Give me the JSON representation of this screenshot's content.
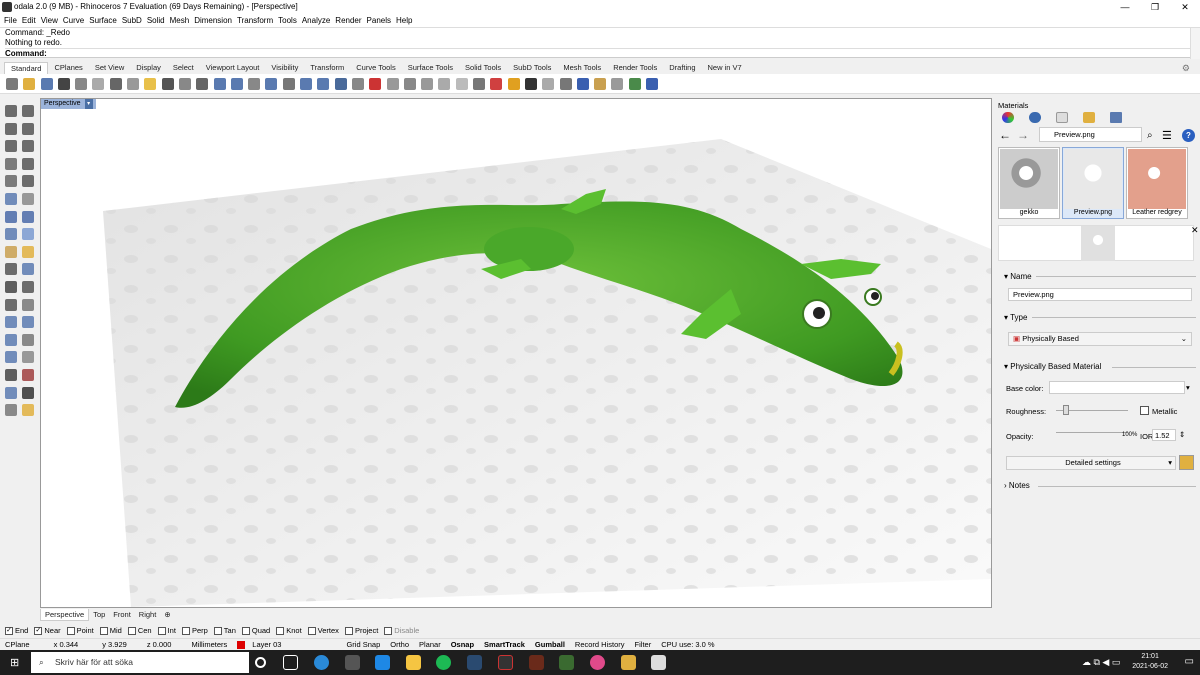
{
  "window": {
    "title": "odala 2.0 (9 MB) - Rhinoceros 7 Evaluation (69 Days Remaining) - [Perspective]",
    "controls": [
      "—",
      "❐",
      "✕"
    ]
  },
  "menu": [
    "File",
    "Edit",
    "View",
    "Curve",
    "Surface",
    "SubD",
    "Solid",
    "Mesh",
    "Dimension",
    "Transform",
    "Tools",
    "Analyze",
    "Render",
    "Panels",
    "Help"
  ],
  "command": {
    "history": [
      "Command: _Redo",
      "Nothing to redo."
    ],
    "prompt": "Command:"
  },
  "toolbar_tabs": [
    "Standard",
    "CPlanes",
    "Set View",
    "Display",
    "Select",
    "Viewport Layout",
    "Visibility",
    "Transform",
    "Curve Tools",
    "Surface Tools",
    "Solid Tools",
    "SubD Tools",
    "Mesh Tools",
    "Render Tools",
    "Drafting",
    "New in V7"
  ],
  "toolbar_icon_colors": [
    "#7a7a7a",
    "#e0b040",
    "#5a7ab0",
    "#444",
    "#888",
    "#aaa",
    "#666",
    "#999",
    "#e8c04a",
    "#555",
    "#888",
    "#666",
    "#5a7ab0",
    "#5a7ab0",
    "#888",
    "#5a7ab0",
    "#777",
    "#5a7ab0",
    "#5a7ab0",
    "#4a6a9a",
    "#888",
    "#c33",
    "#999",
    "#888",
    "#999",
    "#aaa",
    "#bbb",
    "#777",
    "#d04040",
    "#e0a020",
    "#333",
    "#aaa",
    "#777",
    "#3a5fb0",
    "#c9a050",
    "#9a9a9a",
    "#4a8a4a",
    "#3a5fb0"
  ],
  "viewport": {
    "label": "Perspective",
    "dropdown": "▾",
    "tabs": [
      "Perspective",
      "Top",
      "Front",
      "Right",
      "⊕"
    ]
  },
  "osnaps": [
    {
      "label": "End",
      "checked": true
    },
    {
      "label": "Near",
      "checked": true
    },
    {
      "label": "Point",
      "checked": false
    },
    {
      "label": "Mid",
      "checked": false
    },
    {
      "label": "Cen",
      "checked": false
    },
    {
      "label": "Int",
      "checked": false
    },
    {
      "label": "Perp",
      "checked": false
    },
    {
      "label": "Tan",
      "checked": false
    },
    {
      "label": "Quad",
      "checked": false
    },
    {
      "label": "Knot",
      "checked": false
    },
    {
      "label": "Vertex",
      "checked": false
    },
    {
      "label": "Project",
      "checked": false
    },
    {
      "label": "Disable",
      "checked": false
    }
  ],
  "status": {
    "cplane": "CPlane",
    "x": "x 0.344",
    "y": "y 3.929",
    "z": "z 0.000",
    "units": "Millimeters",
    "layer": "Layer 03",
    "layer_color": "#dd0000",
    "toggles": [
      "Grid Snap",
      "Ortho",
      "Planar",
      "Osnap",
      "SmartTrack",
      "Gumball",
      "Record History",
      "Filter"
    ],
    "cpu": "CPU use: 3.0 %"
  },
  "materials_panel": {
    "title": "Materials",
    "path": "Preview.png",
    "thumbnails": [
      {
        "label": "gekko",
        "color": "#bdbdbd"
      },
      {
        "label": "Preview.png",
        "color": "#f4f4f4"
      },
      {
        "label": "Leather redgrey",
        "color": "#e3a08c"
      }
    ],
    "name_header": "Name",
    "name_value": "Preview.png",
    "type_header": "Type",
    "type_value": "Physically Based",
    "pbm_header": "Physically Based Material",
    "base_color_label": "Base color:",
    "roughness_label": "Roughness:",
    "roughness_value": 0.1,
    "metallic_label": "Metallic",
    "opacity_label": "Opacity:",
    "opacity_value": "100%",
    "ior_label": "IOR:",
    "ior_value": "1.52",
    "detailed_settings": "Detailed settings",
    "notes_header": "Notes"
  },
  "taskbar": {
    "search_placeholder": "Skriv här för att söka",
    "time": "21:01",
    "date": "2021-06-02"
  }
}
